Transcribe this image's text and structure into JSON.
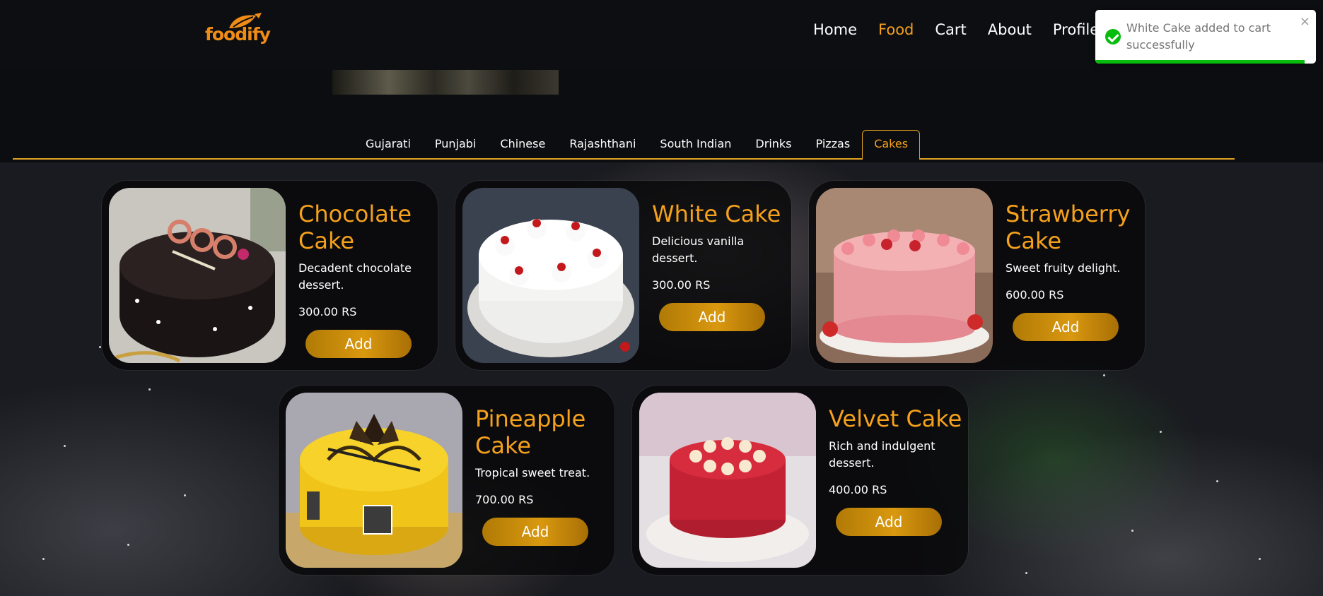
{
  "brand": {
    "name": "foodify",
    "color": "#f08c15"
  },
  "nav": {
    "items": [
      {
        "label": "Home",
        "active": false
      },
      {
        "label": "Food",
        "active": true
      },
      {
        "label": "Cart",
        "active": false
      },
      {
        "label": "About",
        "active": false
      },
      {
        "label": "Profile",
        "active": false
      }
    ]
  },
  "tabs": [
    {
      "label": "Gujarati",
      "active": false
    },
    {
      "label": "Punjabi",
      "active": false
    },
    {
      "label": "Chinese",
      "active": false
    },
    {
      "label": "Rajashthani",
      "active": false
    },
    {
      "label": "South Indian",
      "active": false
    },
    {
      "label": "Drinks",
      "active": false
    },
    {
      "label": "Pizzas",
      "active": false
    },
    {
      "label": "Cakes",
      "active": true
    }
  ],
  "cards": [
    {
      "title": "Chocolate Cake",
      "desc": "Decadent chocolate dessert.",
      "price": "300.00 RS",
      "button": "Add",
      "image": "chocolate-cake-image"
    },
    {
      "title": "White Cake",
      "desc": "Delicious vanilla dessert.",
      "price": "300.00 RS",
      "button": "Add",
      "image": "white-cake-image"
    },
    {
      "title": "Strawberry Cake",
      "desc": "Sweet fruity delight.",
      "price": "600.00 RS",
      "button": "Add",
      "image": "strawberry-cake-image"
    },
    {
      "title": "Pineapple Cake",
      "desc": "Tropical sweet treat.",
      "price": "700.00 RS",
      "button": "Add",
      "image": "pineapple-cake-image"
    },
    {
      "title": "Velvet Cake",
      "desc": "Rich and indulgent dessert.",
      "price": "400.00 RS",
      "button": "Add",
      "image": "velvet-cake-image"
    }
  ],
  "toast": {
    "message": "White Cake added to cart successfully",
    "close": "×",
    "status_color": "#07bc0c",
    "progress": 0.95
  },
  "colors": {
    "accent": "#f5a11b",
    "underline": "#e0a323",
    "button": "#d9980f"
  }
}
